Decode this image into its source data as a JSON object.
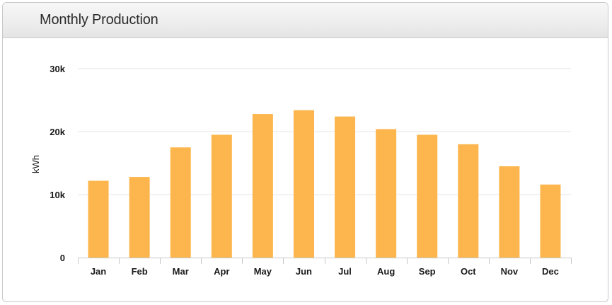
{
  "panel": {
    "title": "Monthly Production"
  },
  "colors": {
    "bar": "#fdb64d",
    "grid": "#e6e6e6",
    "axis": "#c8c8c8"
  },
  "chart_data": {
    "type": "bar",
    "title": "",
    "xlabel": "",
    "ylabel": "kWh",
    "ylim": [
      0,
      30000
    ],
    "yticks": [
      {
        "value": 0,
        "label": "0"
      },
      {
        "value": 10000,
        "label": "10k"
      },
      {
        "value": 20000,
        "label": "20k"
      },
      {
        "value": 30000,
        "label": "30k"
      }
    ],
    "grid": true,
    "categories": [
      "Jan",
      "Feb",
      "Mar",
      "Apr",
      "May",
      "Jun",
      "Jul",
      "Aug",
      "Sep",
      "Oct",
      "Nov",
      "Dec"
    ],
    "values": [
      12200,
      12800,
      17500,
      19500,
      22800,
      23400,
      22400,
      20400,
      19500,
      18000,
      14500,
      11600
    ]
  }
}
